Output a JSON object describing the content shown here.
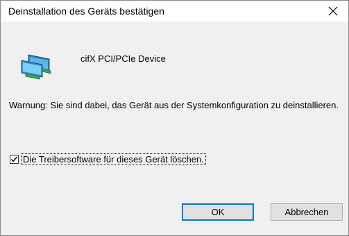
{
  "dialog": {
    "title": "Deinstallation des Geräts bestätigen",
    "device_name": "cifX PCI/PCIe Device",
    "warning_text": "Warnung: Sie sind dabei, das Gerät aus der Systemkonfiguration zu deinstallieren.",
    "checkbox": {
      "label": "Die Treibersoftware für dieses Gerät löschen.",
      "checked": true
    },
    "buttons": {
      "ok_label": "OK",
      "cancel_label": "Abbrechen"
    },
    "icons": {
      "close": "close-icon",
      "device": "network-adapter-icon",
      "check": "checkmark-icon"
    },
    "colors": {
      "accent": "#0078d7",
      "titlebar": "#ffffff",
      "body": "#f0f0f0"
    }
  }
}
